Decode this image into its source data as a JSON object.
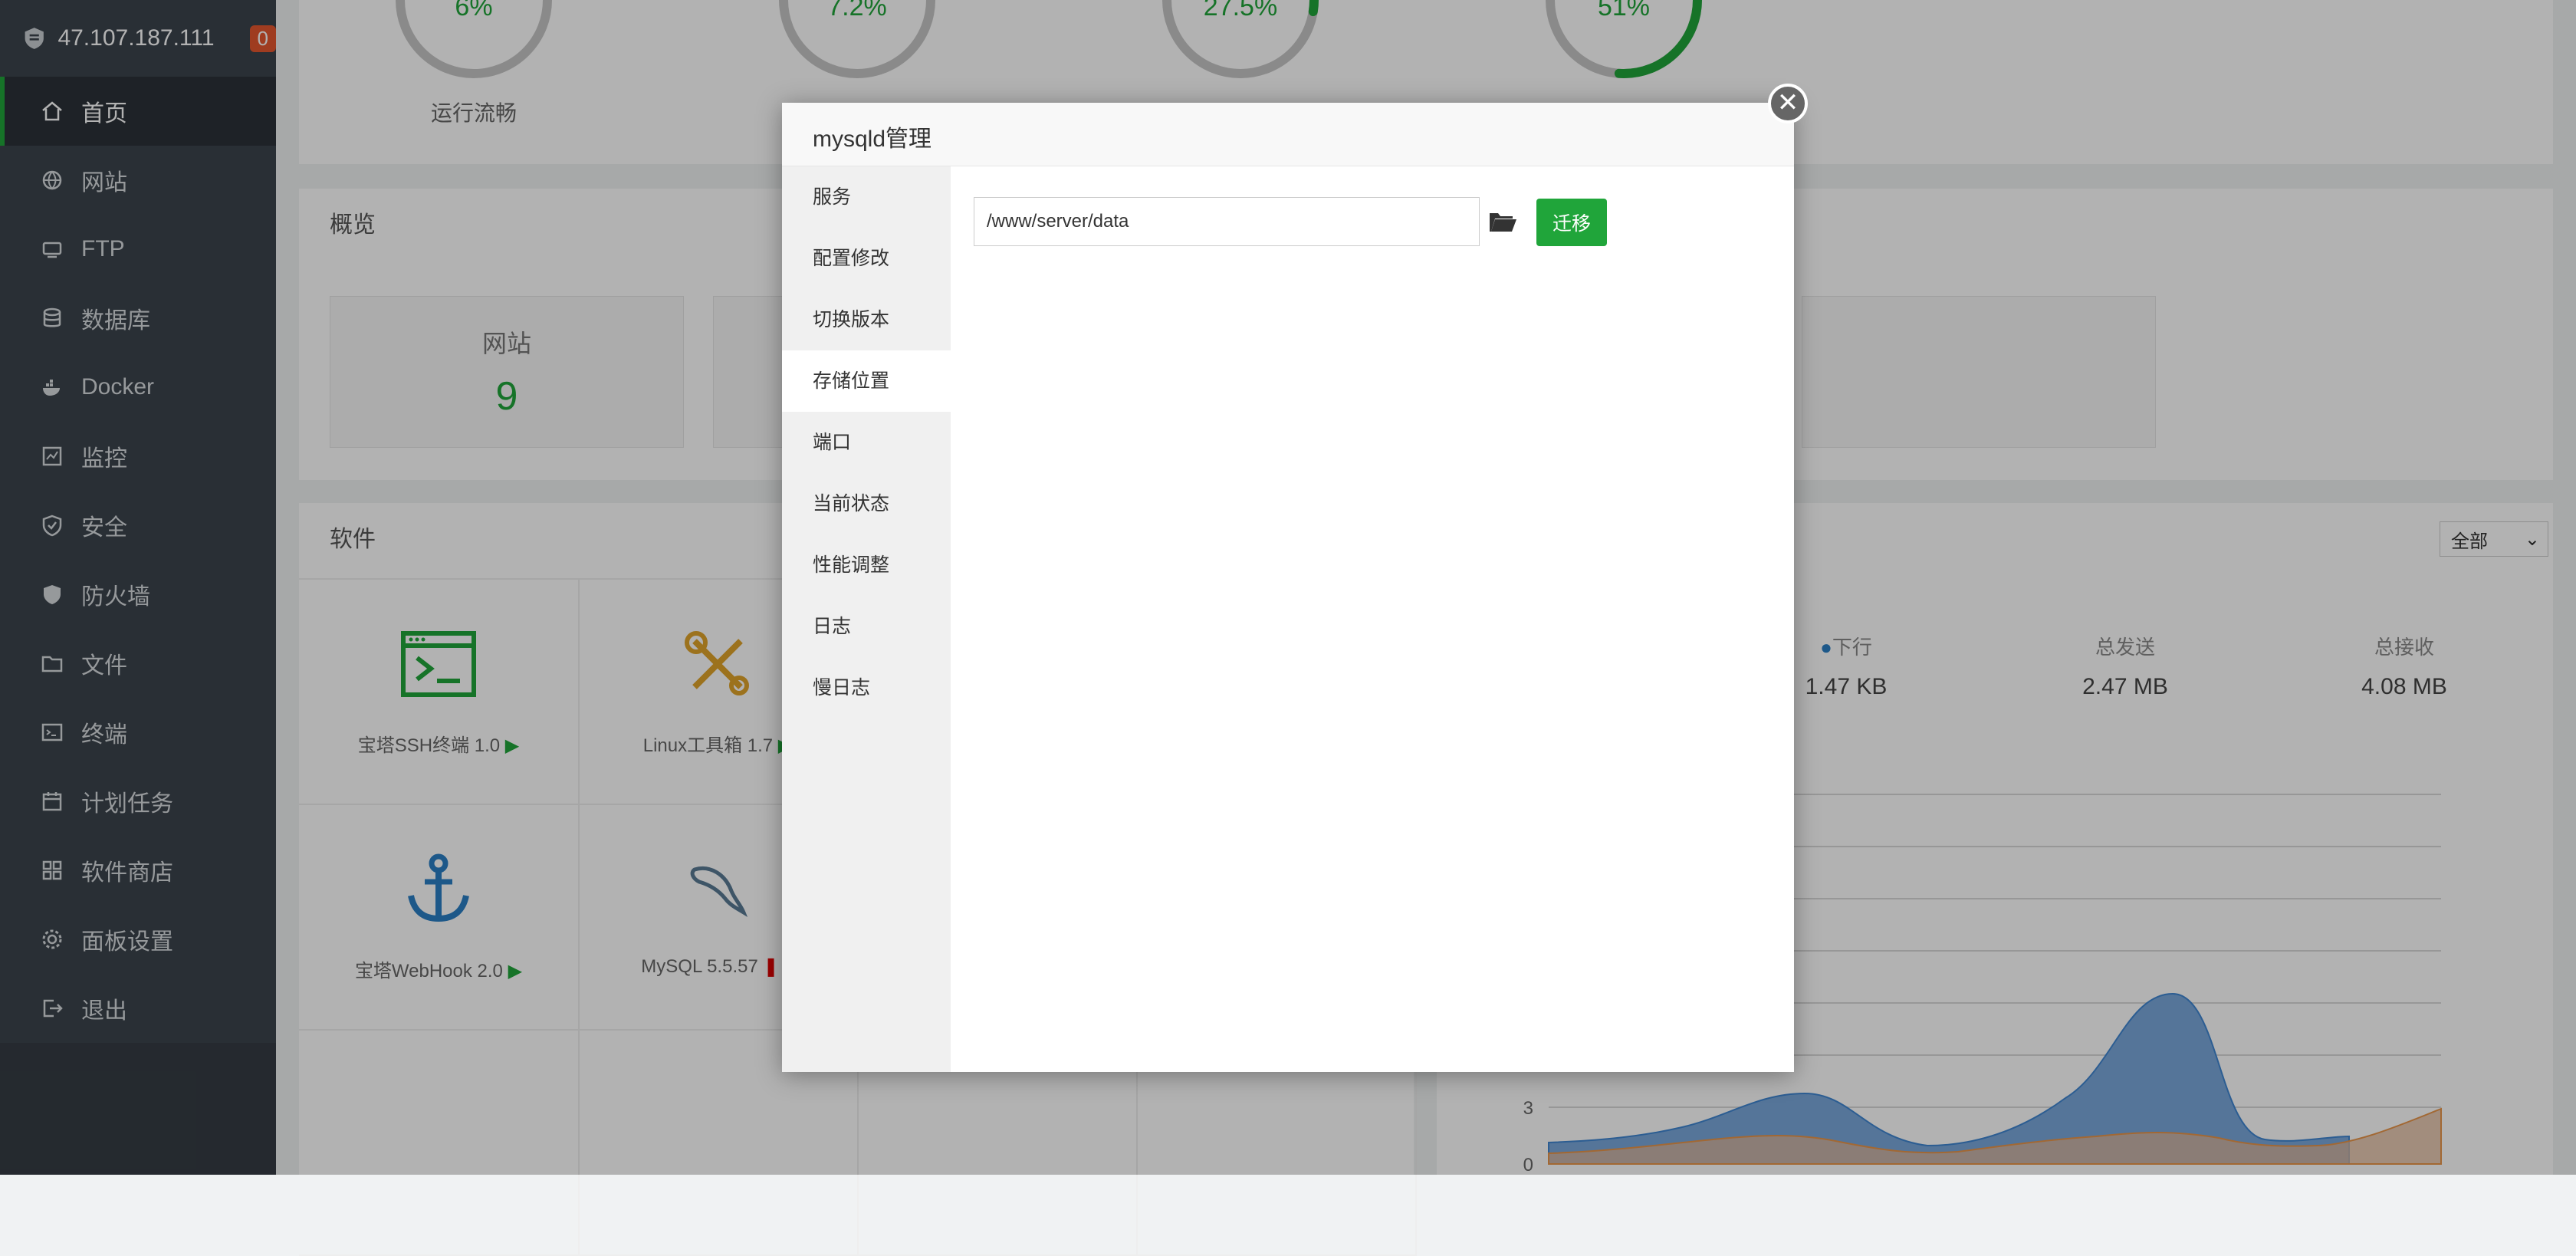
{
  "sidebar": {
    "host": "47.107.187.111",
    "badge": "0",
    "items": [
      {
        "label": "首页",
        "icon": "home-icon"
      },
      {
        "label": "网站",
        "icon": "globe-icon"
      },
      {
        "label": "FTP",
        "icon": "ftp-icon"
      },
      {
        "label": "数据库",
        "icon": "database-icon"
      },
      {
        "label": "Docker",
        "icon": "docker-icon"
      },
      {
        "label": "监控",
        "icon": "monitor-icon"
      },
      {
        "label": "安全",
        "icon": "shield-icon"
      },
      {
        "label": "防火墙",
        "icon": "firewall-icon"
      },
      {
        "label": "文件",
        "icon": "folder-icon"
      },
      {
        "label": "终端",
        "icon": "terminal-icon"
      },
      {
        "label": "计划任务",
        "icon": "calendar-icon"
      },
      {
        "label": "软件商店",
        "icon": "apps-icon"
      },
      {
        "label": "面板设置",
        "icon": "gear-icon"
      },
      {
        "label": "退出",
        "icon": "logout-icon"
      }
    ]
  },
  "status": {
    "gauges": [
      {
        "pct": "6%",
        "label": "运行流畅",
        "fill": 0.06
      },
      {
        "pct": "7.2%",
        "label": "",
        "fill": 0.072
      },
      {
        "pct": "27.5%",
        "label": "",
        "fill": 0.275
      },
      {
        "pct": "51%",
        "label": "",
        "fill": 0.51
      }
    ]
  },
  "overview": {
    "title": "概览",
    "cards": [
      {
        "label": "网站",
        "value": "9"
      }
    ]
  },
  "software": {
    "title": "软件",
    "filter": "全部",
    "items": [
      {
        "name": "宝塔SSH终端 1.0",
        "state": "▶",
        "icon": "terminal-app-icon"
      },
      {
        "name": "Linux工具箱 1.7",
        "state": "▶",
        "icon": "tools-icon"
      },
      {
        "name": "宝塔WebHook 2.0",
        "state": "▶",
        "icon": "anchor-icon"
      },
      {
        "name": "MySQL 5.5.57",
        "state": "❚❚",
        "icon": "mysql-dolphin-icon"
      }
    ]
  },
  "network": {
    "stats": [
      {
        "label": "下行",
        "value": "1.47 KB"
      },
      {
        "label": "总发送",
        "value": "2.47 MB"
      },
      {
        "label": "总接收",
        "value": "4.08 MB"
      }
    ],
    "yticks": [
      "3",
      "0"
    ],
    "colors": {
      "down": "#4a90d9",
      "up": "#f0a050"
    }
  },
  "modal": {
    "title": "mysqld管理",
    "close": "✕",
    "tabs": [
      "服务",
      "配置修改",
      "切换版本",
      "存储位置",
      "端口",
      "当前状态",
      "性能调整",
      "日志",
      "慢日志"
    ],
    "active_tab": "存储位置",
    "path_value": "/www/server/data",
    "migrate_label": "迁移"
  },
  "colors": {
    "accent": "#20a53a",
    "sidebar": "#3c444d"
  }
}
